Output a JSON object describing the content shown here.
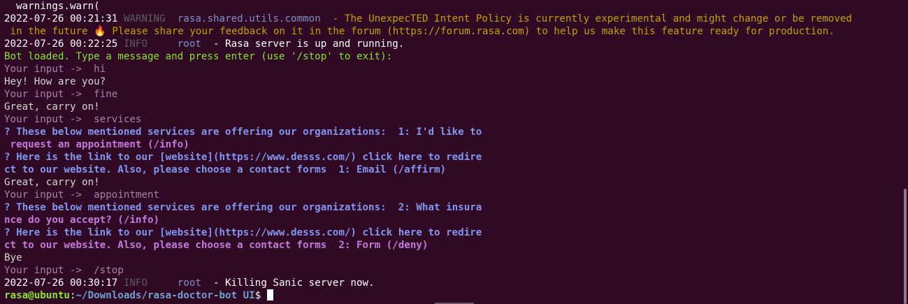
{
  "terminal": {
    "lines": {
      "l0": "  warnings.warn(",
      "l1_ts": "2022-07-26 00:21:31",
      "l1_level": "WARNING",
      "l1_logger": "rasa.shared.utils.common",
      "l1_msg": "- The UnexpecTED Intent Policy is currently experimental and might change or be removed",
      "l2a": " in the future ",
      "l2b": " Please share your feedback on it in the forum (https://forum.rasa.com) to help us make this feature ready for production.",
      "l3_ts": "2022-07-26 00:22:25",
      "l3_level": "INFO",
      "l3_logger": "root",
      "l3_msg": "- Rasa server is up and running.",
      "l4": "Bot loaded. Type a message and press enter (use '/stop' to exit):",
      "l5_prompt": "Your input ->  hi",
      "l6": "Hey! How are you?",
      "l7_prompt": "Your input ->  fine",
      "l8": "Great, carry on!",
      "l9_prompt": "Your input ->  services",
      "l10": "? These below mentioned services are offering our organizations:  1: I'd like to",
      "l11": " request an appointment (/info)",
      "l12": "? Here is the link to our [website](https://www.desss.com/) click here to redire",
      "l13": "ct to our website. Also, please choose a contact forms  1: Email (/affirm)",
      "l14": "Great, carry on!",
      "l15_prompt": "Your input ->  appointment",
      "l16": "? These below mentioned services are offering our organizations:  2: What insura",
      "l17": "nce do you accept? (/info)",
      "l18": "? Here is the link to our [website](https://www.desss.com/) click here to redire",
      "l19": "ct to our website. Also, please choose a contact forms  2: Form (/deny)",
      "l20": "Bye",
      "l21_prompt": "Your input ->  /stop",
      "l22_ts": "2022-07-26 00:30:17",
      "l22_level": "INFO",
      "l22_logger": "root",
      "l22_msg": "- Killing Sanic server now.",
      "sh_user": "rasa@ubuntu",
      "sh_sep": ":",
      "sh_path": "~/Downloads/rasa-doctor-bot UI",
      "sh_dollar": "$ "
    },
    "fire_glyph": "🔥",
    "fire_icon": "fire-emoji"
  },
  "colors": {
    "background": "#300a24",
    "warning_text": "#c4a000",
    "bot_blue": "#8296f0",
    "bot_purple": "#c678dd",
    "prompt": "#ad7fa8",
    "green": "#8ae234"
  }
}
